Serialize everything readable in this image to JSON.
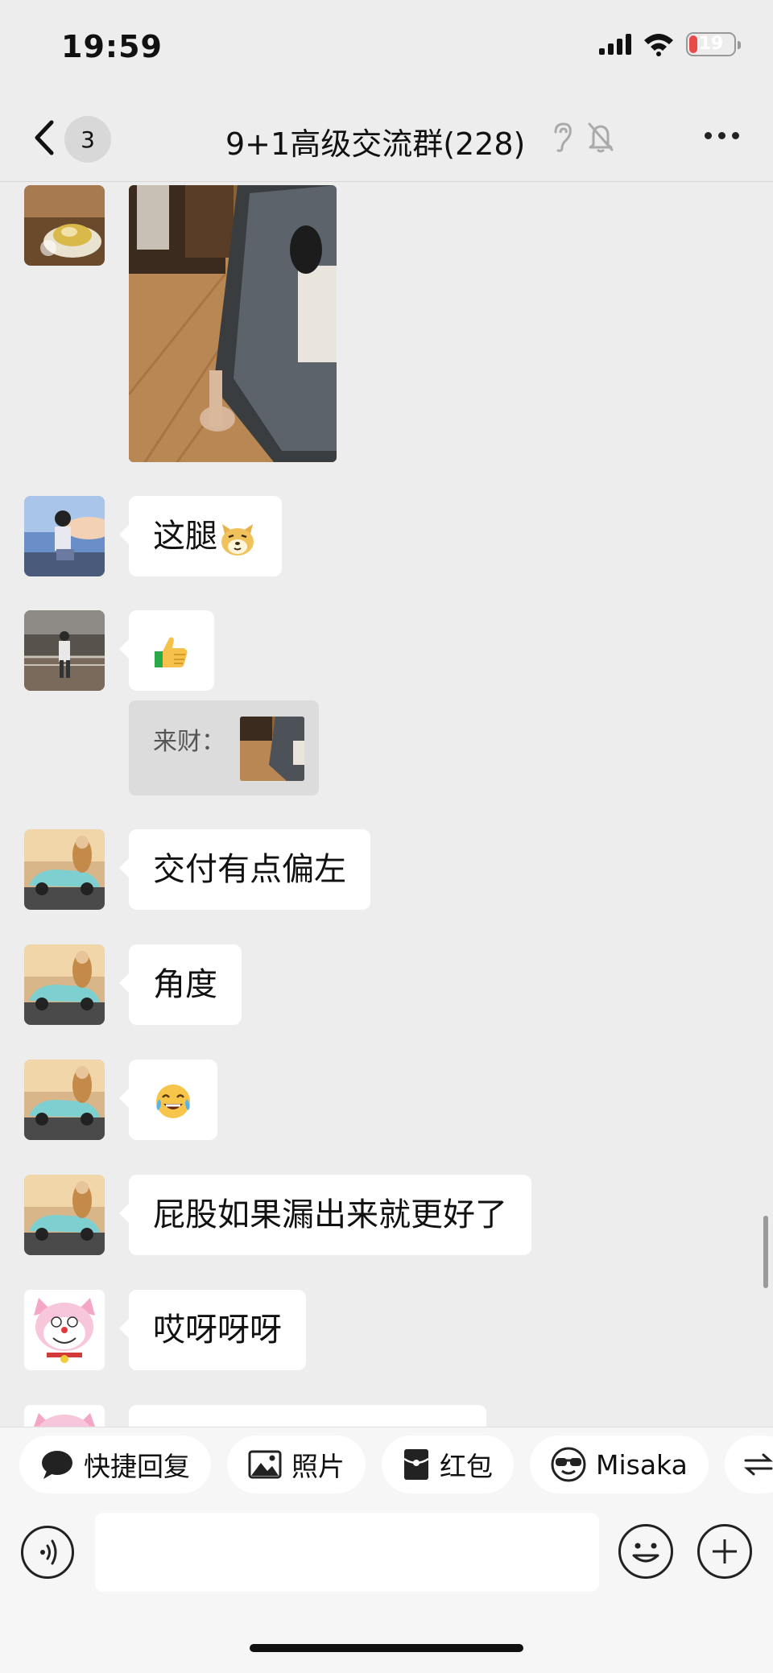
{
  "status_bar": {
    "time": "19:59",
    "battery": "19"
  },
  "nav": {
    "unread_count": "3",
    "title": "9+1高级交流群(228)",
    "icons": [
      "back-icon",
      "earpiece-icon",
      "mute-bell-icon",
      "more-icon"
    ]
  },
  "messages": [
    {
      "type": "image",
      "avatar": "coffee-avatar"
    },
    {
      "type": "text",
      "text": "这腿",
      "emoji": "doge-emoji",
      "avatar": "anime-boy-avatar"
    },
    {
      "type": "emoji",
      "emoji": "thumbs-up-emoji",
      "avatar": "street-photo-avatar"
    },
    {
      "type": "quote",
      "sender": "来财：",
      "thumbnail": "floor-photo-thumbnail"
    },
    {
      "type": "text",
      "text": "交付有点偏左",
      "avatar": "car-avatar"
    },
    {
      "type": "text",
      "text": "角度",
      "avatar": "car-avatar"
    },
    {
      "type": "emoji",
      "emoji": "tears-of-joy-emoji",
      "avatar": "car-avatar"
    },
    {
      "type": "text",
      "text": "屁股如果漏出来就更好了",
      "avatar": "car-avatar"
    },
    {
      "type": "text",
      "text": "哎呀呀呀",
      "avatar": "pink-cat-avatar"
    }
  ],
  "quick_replies": [
    {
      "label": "快捷回复",
      "icon": "chat-bubble-icon"
    },
    {
      "label": "照片",
      "icon": "photo-icon"
    },
    {
      "label": "红包",
      "icon": "red-packet-icon"
    },
    {
      "label": "Misaka",
      "icon": "sunglasses-icon"
    }
  ],
  "input": {
    "placeholder": ""
  }
}
